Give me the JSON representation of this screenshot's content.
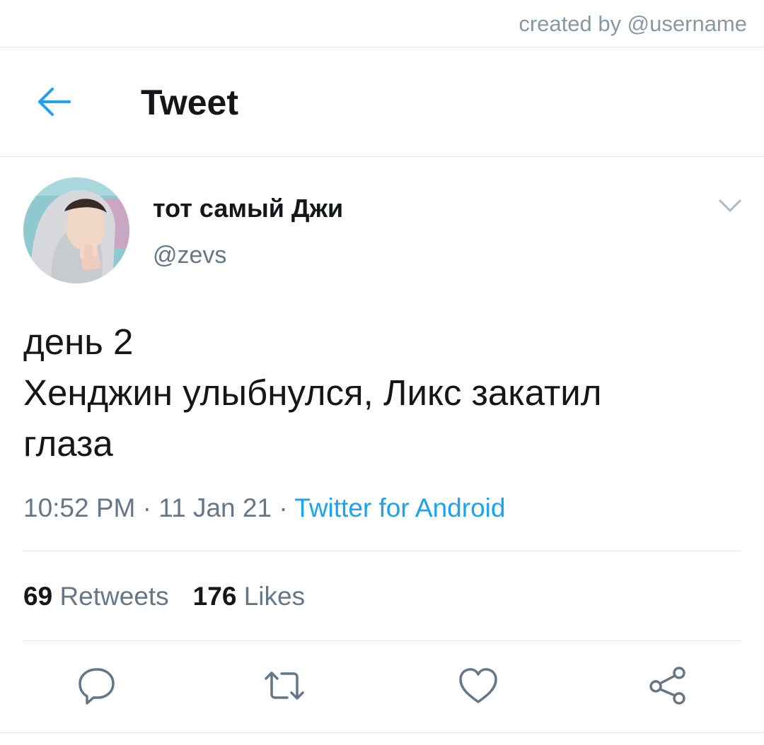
{
  "credit": "created by @username",
  "header": {
    "title": "Tweet",
    "back_icon": "arrow-left-icon"
  },
  "author": {
    "display_name": "тот самый Джи",
    "handle": "@zevs"
  },
  "tweet": {
    "lines": [
      "день 2",
      "Хенджин улыбнулся, Ликс закатил",
      "глаза"
    ],
    "time": "10:52 PM",
    "separator": " · ",
    "date": "11 Jan 21",
    "source": "Twitter for Android"
  },
  "stats": {
    "retweets_count": "69",
    "retweets_label": "Retweets",
    "likes_count": "176",
    "likes_label": "Likes"
  },
  "actions": [
    {
      "icon": "reply-icon"
    },
    {
      "icon": "retweet-icon"
    },
    {
      "icon": "like-icon"
    },
    {
      "icon": "share-icon"
    }
  ],
  "colors": {
    "accent": "#1da1f2",
    "text_primary": "#14171a",
    "text_secondary": "#657786",
    "divider": "#e1e8ed"
  }
}
